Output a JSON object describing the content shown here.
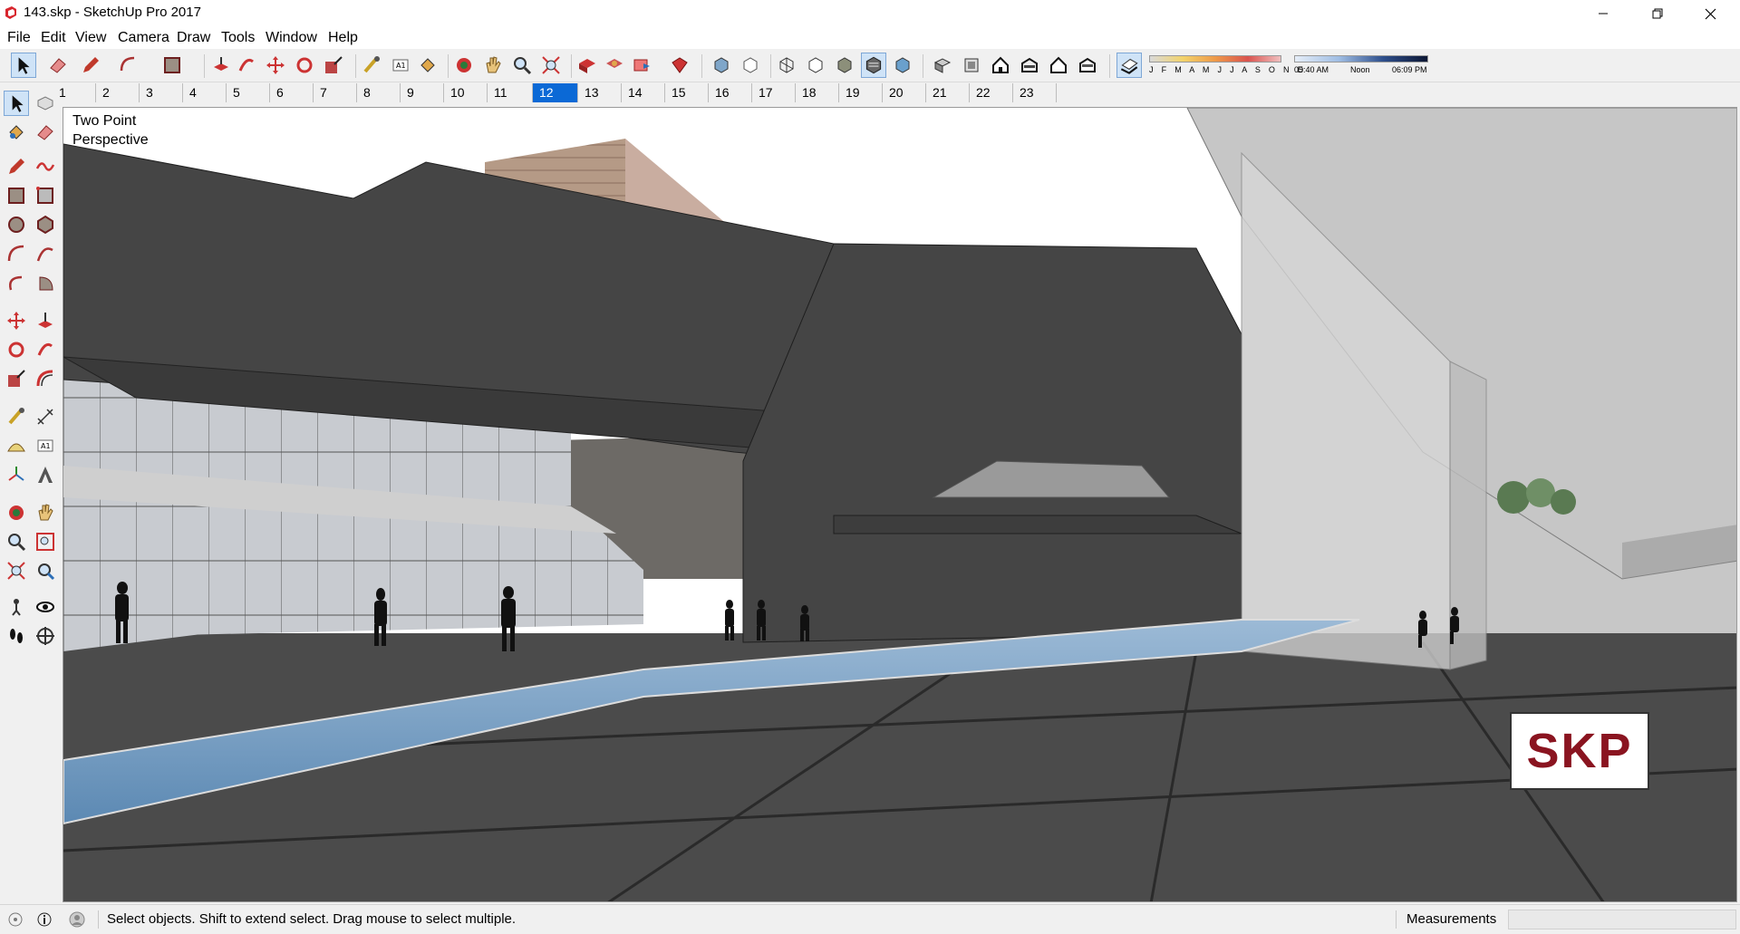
{
  "window": {
    "title": "143.skp - SketchUp Pro 2017"
  },
  "menu": [
    "File",
    "Edit",
    "View",
    "Camera",
    "Draw",
    "Tools",
    "Window",
    "Help"
  ],
  "shadow_settings": {
    "months": "J F M A M J J A S O N D",
    "time_start": "05:40 AM",
    "time_mid": "Noon",
    "time_end": "06:09 PM"
  },
  "scenes": {
    "tabs": [
      "1",
      "2",
      "3",
      "4",
      "5",
      "6",
      "7",
      "8",
      "9",
      "10",
      "11",
      "12",
      "13",
      "14",
      "15",
      "16",
      "17",
      "18",
      "19",
      "20",
      "21",
      "22",
      "23"
    ],
    "active": "12"
  },
  "viewport": {
    "camera_label_line1": "Two Point",
    "camera_label_line2": "Perspective",
    "watermark": "SKP"
  },
  "status": {
    "message": "Select objects. Shift to extend select. Drag mouse to select multiple.",
    "measurements_label": "Measurements",
    "measurements_value": ""
  },
  "colors": {
    "accent": "#0b69d6",
    "water": "#7fa6c9",
    "building_dark": "#434343",
    "ground": "#4a4a4a",
    "brand_red": "#8a1420"
  }
}
